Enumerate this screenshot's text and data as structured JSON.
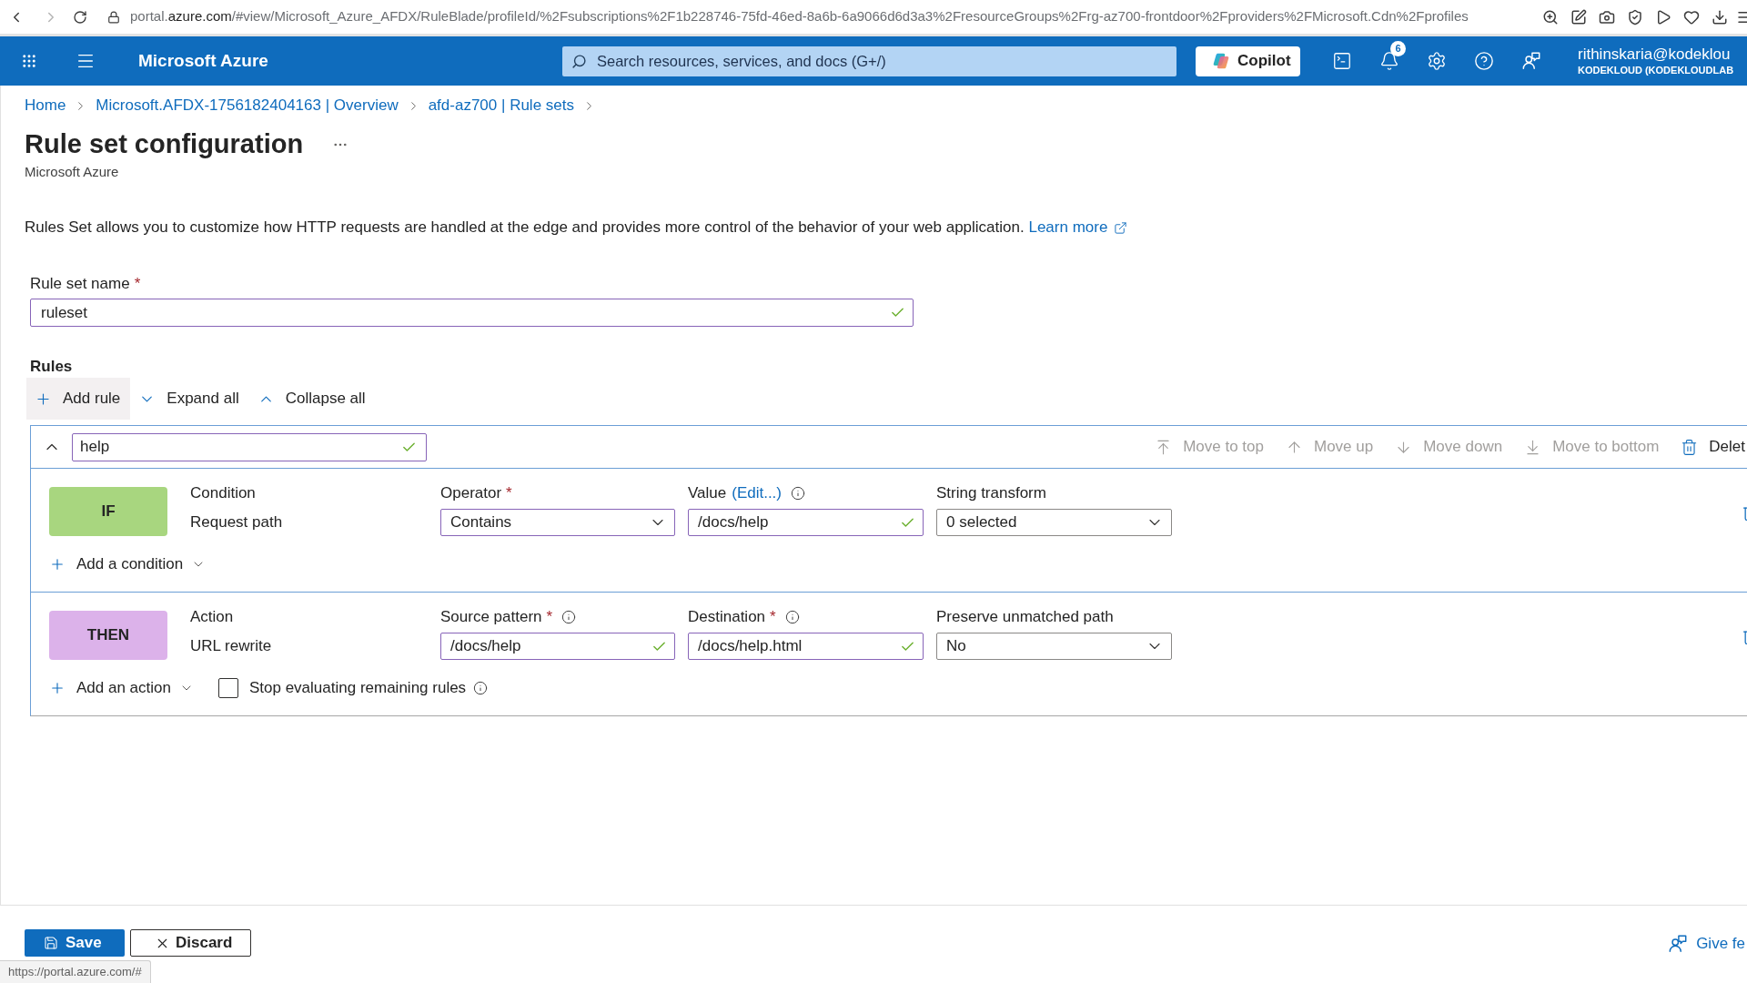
{
  "browser": {
    "url": {
      "subdomain": "portal.",
      "domain": "azure.com",
      "path": "/#view/Microsoft_Azure_AFDX/RuleBlade/profileId/%2Fsubscriptions%2F1b228746-75fd-46ed-8a6b-6a9066d6d3a3%2FresourceGroups%2Frg-az700-frontdoor%2Fproviders%2FMicrosoft.Cdn%2Fprofiles"
    }
  },
  "header": {
    "product": "Microsoft Azure",
    "search": {
      "placeholder": "Search resources, services, and docs (G+/)"
    },
    "copilot": {
      "label": "Copilot"
    },
    "notifications": {
      "count": "6"
    },
    "account": {
      "user": "rithinskaria@kodeklou",
      "directory": "KODEKLOUD (KODEKLOUDLAB"
    }
  },
  "breadcrumb": [
    {
      "label": "Home"
    },
    {
      "label": "Microsoft.AFDX-1756182404163 | Overview"
    },
    {
      "label": "afd-az700 | Rule sets"
    }
  ],
  "page": {
    "title": "Rule set configuration",
    "subtitle": "Microsoft Azure",
    "description": "Rules Set allows you to customize how HTTP requests are handled at the edge and provides more control of the behavior of your web application.",
    "learn_more": "Learn more"
  },
  "rule_set_name": {
    "label": "Rule set name",
    "required_mark": "*",
    "value": "ruleset",
    "valid": true,
    "touched": true
  },
  "rules": {
    "heading": "Rules",
    "toolbar": [
      {
        "kind": "add",
        "label": "Add rule",
        "hovered": true
      },
      {
        "kind": "expand",
        "label": "Expand all",
        "hovered": false
      },
      {
        "kind": "collapse",
        "label": "Collapse all",
        "hovered": false
      }
    ],
    "items": [
      {
        "expanded": true,
        "name": {
          "value": "help",
          "valid": true,
          "touched": true
        },
        "actions": [
          {
            "kind": "top",
            "label": "Move to top",
            "disabled": true
          },
          {
            "kind": "up",
            "label": "Move up",
            "disabled": true
          },
          {
            "kind": "down",
            "label": "Move down",
            "disabled": true
          },
          {
            "kind": "bottom",
            "label": "Move to bottom",
            "disabled": true
          },
          {
            "kind": "delete",
            "label": "Delet",
            "disabled": false
          }
        ],
        "sections": [
          {
            "kind": "if",
            "badge": "IF",
            "heading": "Condition",
            "type": "Request path",
            "fields": [
              {
                "kind": "dropdown",
                "label": "Operator",
                "required_mark": "*",
                "value": "Contains",
                "touched": true
              },
              {
                "kind": "text",
                "label": "Value",
                "edit_link": "(Edit...)",
                "info": true,
                "value": "/docs/help",
                "valid": true,
                "touched": true
              },
              {
                "kind": "dropdown",
                "label": "String transform",
                "value": "0 selected",
                "touched": false
              }
            ],
            "add": "Add a condition"
          },
          {
            "kind": "then",
            "badge": "THEN",
            "heading": "Action",
            "type": "URL rewrite",
            "fields": [
              {
                "kind": "text",
                "label": "Source pattern",
                "required_mark": "*",
                "info": true,
                "value": "/docs/help",
                "valid": true,
                "touched": true
              },
              {
                "kind": "text",
                "label": "Destination",
                "required_mark": "*",
                "info": true,
                "value": "/docs/help.html",
                "valid": true,
                "touched": true
              },
              {
                "kind": "dropdown",
                "label": "Preserve unmatched path",
                "value": "No",
                "touched": false
              }
            ],
            "add": "Add an action",
            "stop_evaluating": {
              "label": "Stop evaluating remaining rules",
              "checked": false,
              "info": true
            }
          }
        ]
      }
    ]
  },
  "footer": {
    "buttons": [
      {
        "kind": "primary",
        "label": "Save"
      },
      {
        "kind": "secondary",
        "label": "Discard"
      }
    ],
    "feedback": "Give fe"
  },
  "status_link": "https://portal.azure.com/#"
}
